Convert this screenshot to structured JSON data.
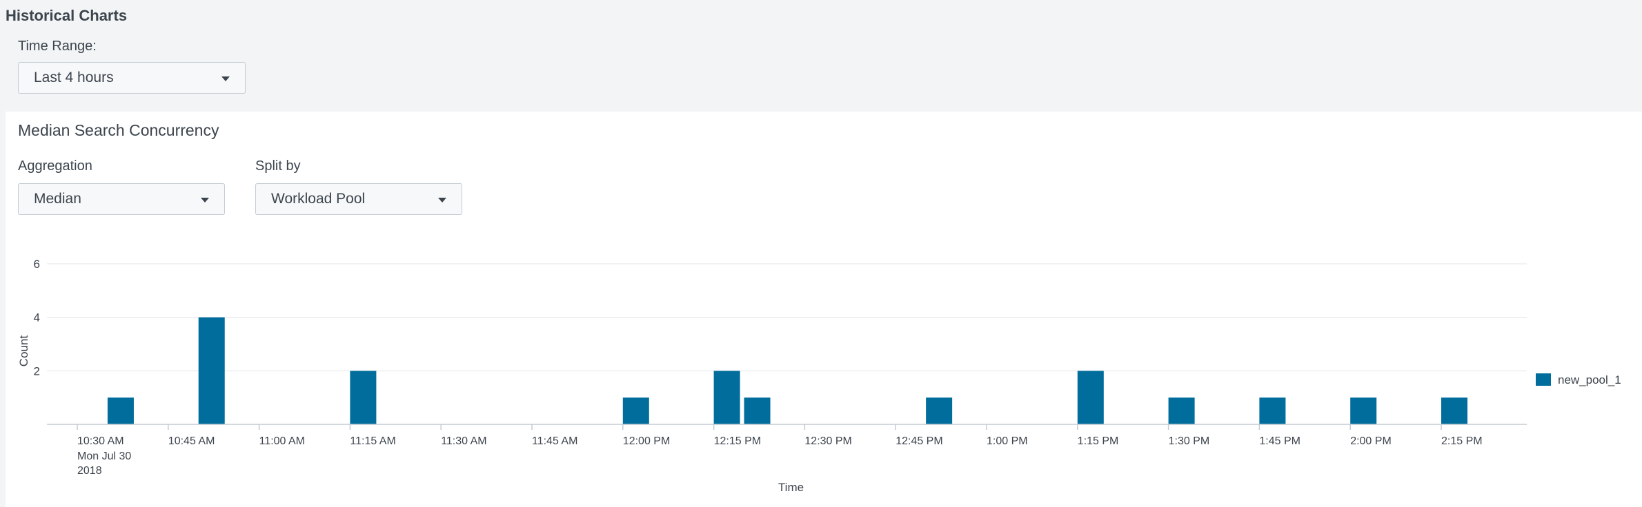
{
  "header": {
    "title": "Historical Charts"
  },
  "time_range": {
    "label": "Time Range:",
    "value": "Last 4 hours"
  },
  "panel": {
    "title": "Median Search Concurrency",
    "aggregation": {
      "label": "Aggregation",
      "value": "Median"
    },
    "split_by": {
      "label": "Split by",
      "value": "Workload Pool"
    }
  },
  "colors": {
    "series": "#006d9c",
    "grid": "#e1e4e8",
    "axis": "#c3cbd4"
  },
  "chart_data": {
    "type": "bar",
    "xlabel": "Time",
    "ylabel": "Count",
    "ylim": [
      0,
      6
    ],
    "y_ticks": [
      "2",
      "4",
      "6"
    ],
    "x_ticks": [
      "10:30 AM",
      "10:45 AM",
      "11:00 AM",
      "11:15 AM",
      "11:30 AM",
      "11:45 AM",
      "12:00 PM",
      "12:15 PM",
      "12:30 PM",
      "12:45 PM",
      "1:00 PM",
      "1:15 PM",
      "1:30 PM",
      "1:45 PM",
      "2:00 PM",
      "2:15 PM"
    ],
    "x_tick_date": [
      "Mon Jul 30",
      "2018"
    ],
    "legend_position": "right",
    "series": [
      {
        "name": "new_pool_1",
        "x": [
          "10:35 AM",
          "10:50 AM",
          "11:15 AM",
          "12:00 PM",
          "12:15 PM",
          "12:20 PM",
          "12:50 PM",
          "1:15 PM",
          "1:30 PM",
          "1:45 PM",
          "2:00 PM",
          "2:15 PM"
        ],
        "values": [
          1,
          4,
          2,
          1,
          2,
          1,
          1,
          2,
          1,
          1,
          1,
          1
        ]
      }
    ]
  }
}
